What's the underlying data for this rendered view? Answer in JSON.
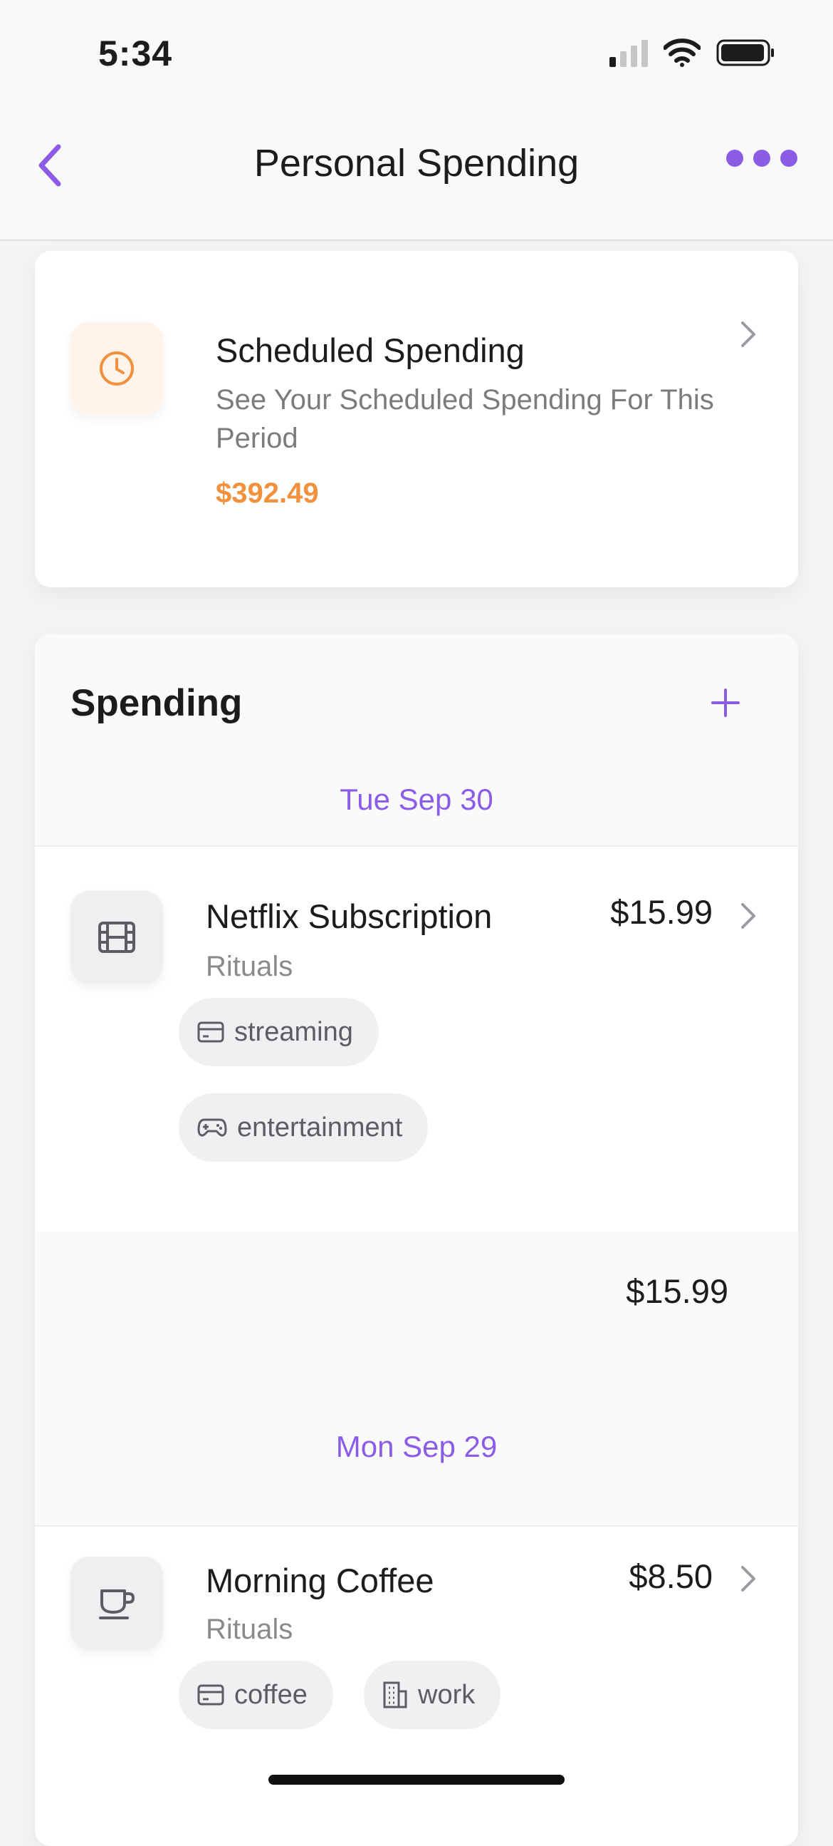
{
  "status_bar": {
    "time": "5:34"
  },
  "nav": {
    "title": "Personal Spending"
  },
  "scheduled": {
    "title": "Scheduled Spending",
    "description": "See Your Scheduled Spending For This Period",
    "amount": "$392.49",
    "accent_color": "#f2913d"
  },
  "spending": {
    "title": "Spending",
    "groups": [
      {
        "date": "Tue Sep 30",
        "items": [
          {
            "title": "Netflix Subscription",
            "category": "Rituals",
            "amount": "$15.99",
            "icon": "film-icon",
            "tags": [
              {
                "label": "streaming",
                "icon": "card-icon"
              },
              {
                "label": "entertainment",
                "icon": "gamepad-icon"
              }
            ]
          }
        ],
        "total": "$15.99"
      },
      {
        "date": "Mon Sep 29",
        "items": [
          {
            "title": "Morning Coffee",
            "category": "Rituals",
            "amount": "$8.50",
            "icon": "cup-icon",
            "tags": [
              {
                "label": "coffee",
                "icon": "card-icon"
              },
              {
                "label": "work",
                "icon": "building-icon"
              }
            ]
          }
        ]
      }
    ]
  },
  "theme": {
    "accent": "#8b5ce6"
  }
}
